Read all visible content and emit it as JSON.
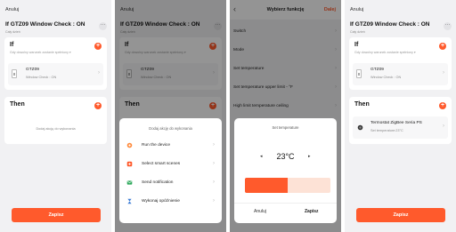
{
  "common": {
    "cancel": "Anuluj",
    "scene_title": "If GTZ09 Window Check : ON",
    "subtitle": "Cały dzień",
    "if_title": "If",
    "if_sub": "Gdy dowolny warunek zostanie spełniony ▾",
    "device_name": "GTZ09",
    "device_status": "Window Check : ON",
    "then_title": "Then",
    "save": "Zapisz",
    "more": "···",
    "plus": "+",
    "chevron_right": "›"
  },
  "panel1": {
    "empty_action": "Dodaj akcję do wykonania"
  },
  "panel2": {
    "sheet_title": "Dodaj akcję do wykonania",
    "actions": [
      {
        "label": "Run the device",
        "icon": "device-icon",
        "color": "#ff8a3c"
      },
      {
        "label": "Select smart scenes",
        "icon": "scene-icon",
        "color": "#ff5a2c"
      },
      {
        "label": "Send notification",
        "icon": "notification-icon",
        "color": "#2ca85a"
      },
      {
        "label": "Wykonaj opóźnienie",
        "icon": "hourglass-icon",
        "color": "#3a7bd5"
      }
    ]
  },
  "panel3": {
    "back": "‹",
    "header_title": "Wybierz funkcję",
    "done": "Dalej",
    "functions": [
      "Switch",
      "Mode",
      "Set temperature",
      "Set temperature upper limit - °F",
      "High limit temperature ceiling"
    ],
    "sheet_title": "Set temperature",
    "temp_value": "23°C",
    "temp_percent": 0.5,
    "cancel": "Anuluj",
    "save": "Zapisz",
    "arrow_left": "◂",
    "arrow_right": "▸"
  },
  "panel4": {
    "action_name": "Termostat ZigBee Seria PS",
    "action_sub": "Set temperature:23°C"
  },
  "colors": {
    "accent": "#ff5a2c",
    "slider_bg": "#fde2d6"
  }
}
